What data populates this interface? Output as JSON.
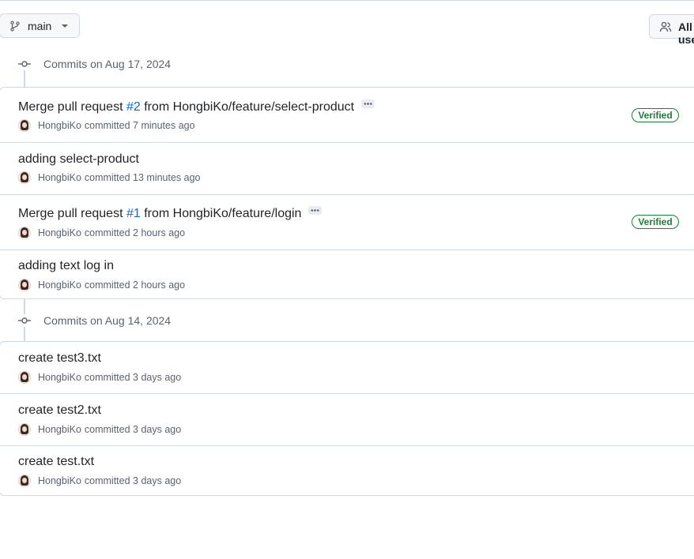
{
  "toolbar": {
    "branch_label": "main",
    "users_label": "All users"
  },
  "groups": [
    {
      "title": "Commits on Aug 17, 2024",
      "commits": [
        {
          "title_prefix": "Merge pull request ",
          "pr": "#2",
          "title_suffix": " from HongbiKo/feature/select-product",
          "author": "HongbiKo",
          "committed": "committed 7 minutes ago",
          "badge": "Verified"
        },
        {
          "title_prefix": "adding select-product",
          "pr": "",
          "title_suffix": "",
          "author": "HongbiKo",
          "committed": "committed 13 minutes ago",
          "badge": ""
        },
        {
          "title_prefix": "Merge pull request ",
          "pr": "#1",
          "title_suffix": " from HongbiKo/feature/login",
          "author": "HongbiKo",
          "committed": "committed 2 hours ago",
          "badge": "Verified"
        },
        {
          "title_prefix": "adding text log in",
          "pr": "",
          "title_suffix": "",
          "author": "HongbiKo",
          "committed": "committed 2 hours ago",
          "badge": ""
        }
      ]
    },
    {
      "title": "Commits on Aug 14, 2024",
      "commits": [
        {
          "title_prefix": "create test3.txt",
          "pr": "",
          "title_suffix": "",
          "author": "HongbiKo",
          "committed": "committed 3 days ago",
          "badge": ""
        },
        {
          "title_prefix": "create test2.txt",
          "pr": "",
          "title_suffix": "",
          "author": "HongbiKo",
          "committed": "committed 3 days ago",
          "badge": ""
        },
        {
          "title_prefix": "create test.txt",
          "pr": "",
          "title_suffix": "",
          "author": "HongbiKo",
          "committed": "committed 3 days ago",
          "badge": ""
        }
      ]
    }
  ],
  "colors": {
    "link": "#0969da",
    "verified": "#1a7f37",
    "border": "#d1d9e0",
    "muted": "#59636e"
  },
  "icons": [
    "git-branch-icon",
    "people-icon",
    "commit-node-icon",
    "ellipsis-icon",
    "avatar"
  ]
}
